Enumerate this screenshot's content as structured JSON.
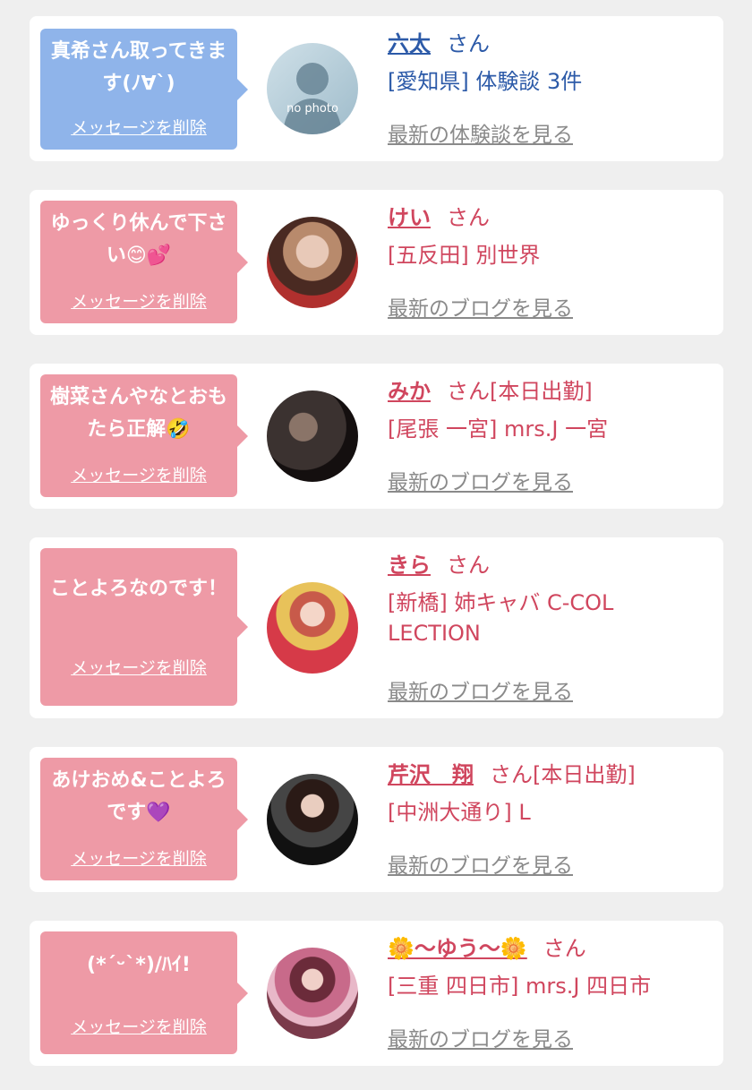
{
  "items": [
    {
      "message": "真希さん取ってきます(ﾉ∀`)",
      "delete_label": "メッセージを削除",
      "name": "六太",
      "suffix": "さん",
      "shop": "[愛知県] 体験談 3件",
      "link": "最新の体験談を見る",
      "avatar_text": "no photo",
      "theme": "blue"
    },
    {
      "message": "ゆっくり休んで下さい😊💕",
      "delete_label": "メッセージを削除",
      "name": "けい",
      "suffix": "さん",
      "shop": "[五反田] 別世界",
      "link": "最新のブログを見る",
      "theme": "pink"
    },
    {
      "message": "樹菜さんやなとおもたら正解🤣",
      "delete_label": "メッセージを削除",
      "name": "みか",
      "suffix": "さん[本日出勤]",
      "shop": "[尾張 一宮] mrs.J 一宮",
      "link": "最新のブログを見る",
      "theme": "pink"
    },
    {
      "message": "ことよろなのです！",
      "delete_label": "メッセージを削除",
      "name": "きら",
      "suffix": "さん",
      "shop": "[新橋] 姉キャバ C-COLLECTION",
      "link": "最新のブログを見る",
      "theme": "pink"
    },
    {
      "message": "あけおめ&ことよろです💜",
      "delete_label": "メッセージを削除",
      "name": "芹沢　翔",
      "suffix": "さん[本日出勤]",
      "shop": "[中洲大通り] L",
      "link": "最新のブログを見る",
      "theme": "pink"
    },
    {
      "message": "(*´ᵕ`*)/ﾊｲ!",
      "delete_label": "メッセージを削除",
      "name": "🌼〜ゆう〜🌼",
      "suffix": "さん",
      "shop": "[三重 四日市] mrs.J 四日市",
      "link": "最新のブログを見る",
      "theme": "pink"
    }
  ]
}
